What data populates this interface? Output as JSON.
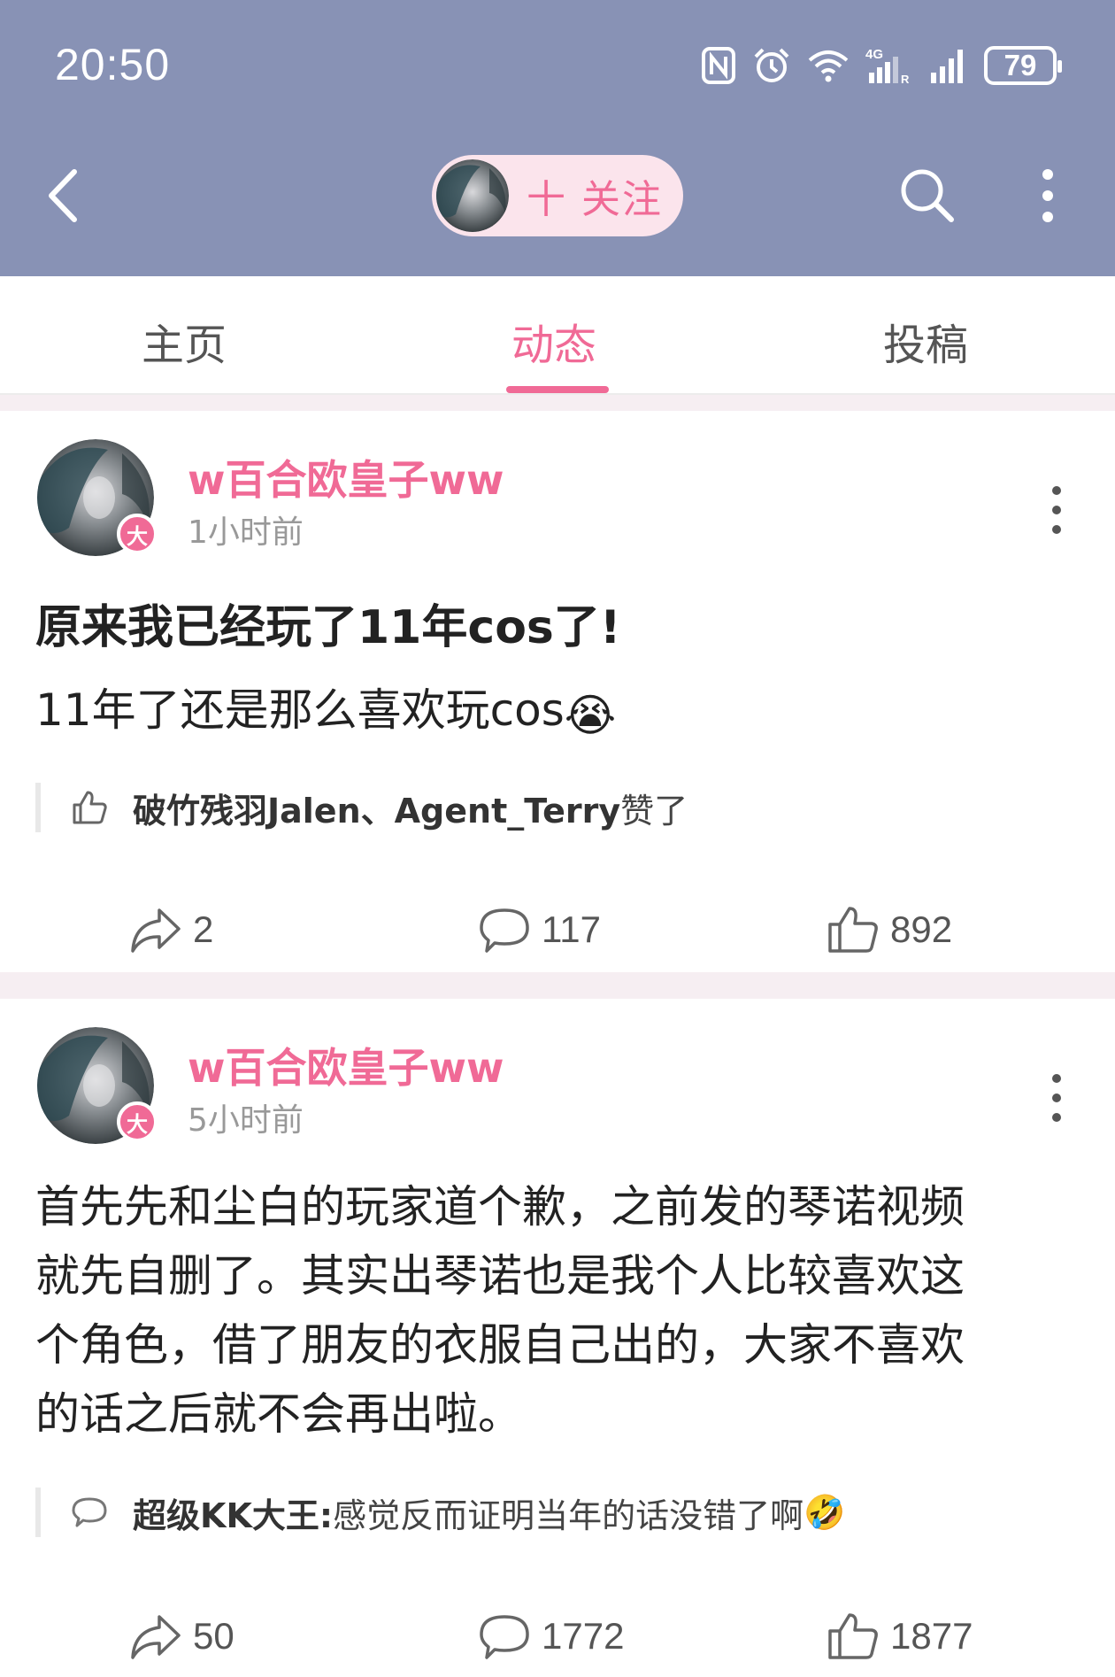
{
  "status_bar": {
    "time": "20:50",
    "icons": [
      "nfc-icon",
      "alarm-icon",
      "wifi-icon",
      "4g-signal-icon",
      "signal-icon"
    ],
    "battery": "79"
  },
  "nav": {
    "follow_label": "十 关注"
  },
  "tabs": [
    {
      "label": "主页"
    },
    {
      "label": "动态"
    },
    {
      "label": "投稿"
    }
  ],
  "active_tab": "动态",
  "colors": {
    "header_bg": "#8892b5",
    "accent": "#f06a96",
    "pill_bg": "#fbe4ec"
  },
  "posts": [
    {
      "author": "w百合欧皇子ww",
      "badge": "大",
      "time": "1小时前",
      "title": "原来我已经玩了11年cos了!",
      "body": "11年了还是那么喜欢玩cos",
      "body_emoji": "😭",
      "quote_users": "破竹残羽Jalen、Agent_Terry",
      "quote_suffix": " 赞了",
      "shares": "2",
      "comments": "117",
      "likes": "892"
    },
    {
      "author": "w百合欧皇子ww",
      "badge": "大",
      "time": "5小时前",
      "body_lines": [
        "首先先和尘白的玩家道个歉，之前发的琴诺视频",
        "就先自删了。其实出琴诺也是我个人比较喜欢这",
        "个角色，借了朋友的衣服自己出的，大家不喜欢",
        "的话之后就不会再出啦。"
      ],
      "quote_user": "超级KK大王:",
      "quote_text": " 感觉反而证明当年的话没错了啊",
      "quote_emoji": "🤣",
      "shares": "50",
      "comments": "1772",
      "likes": "1877"
    }
  ]
}
